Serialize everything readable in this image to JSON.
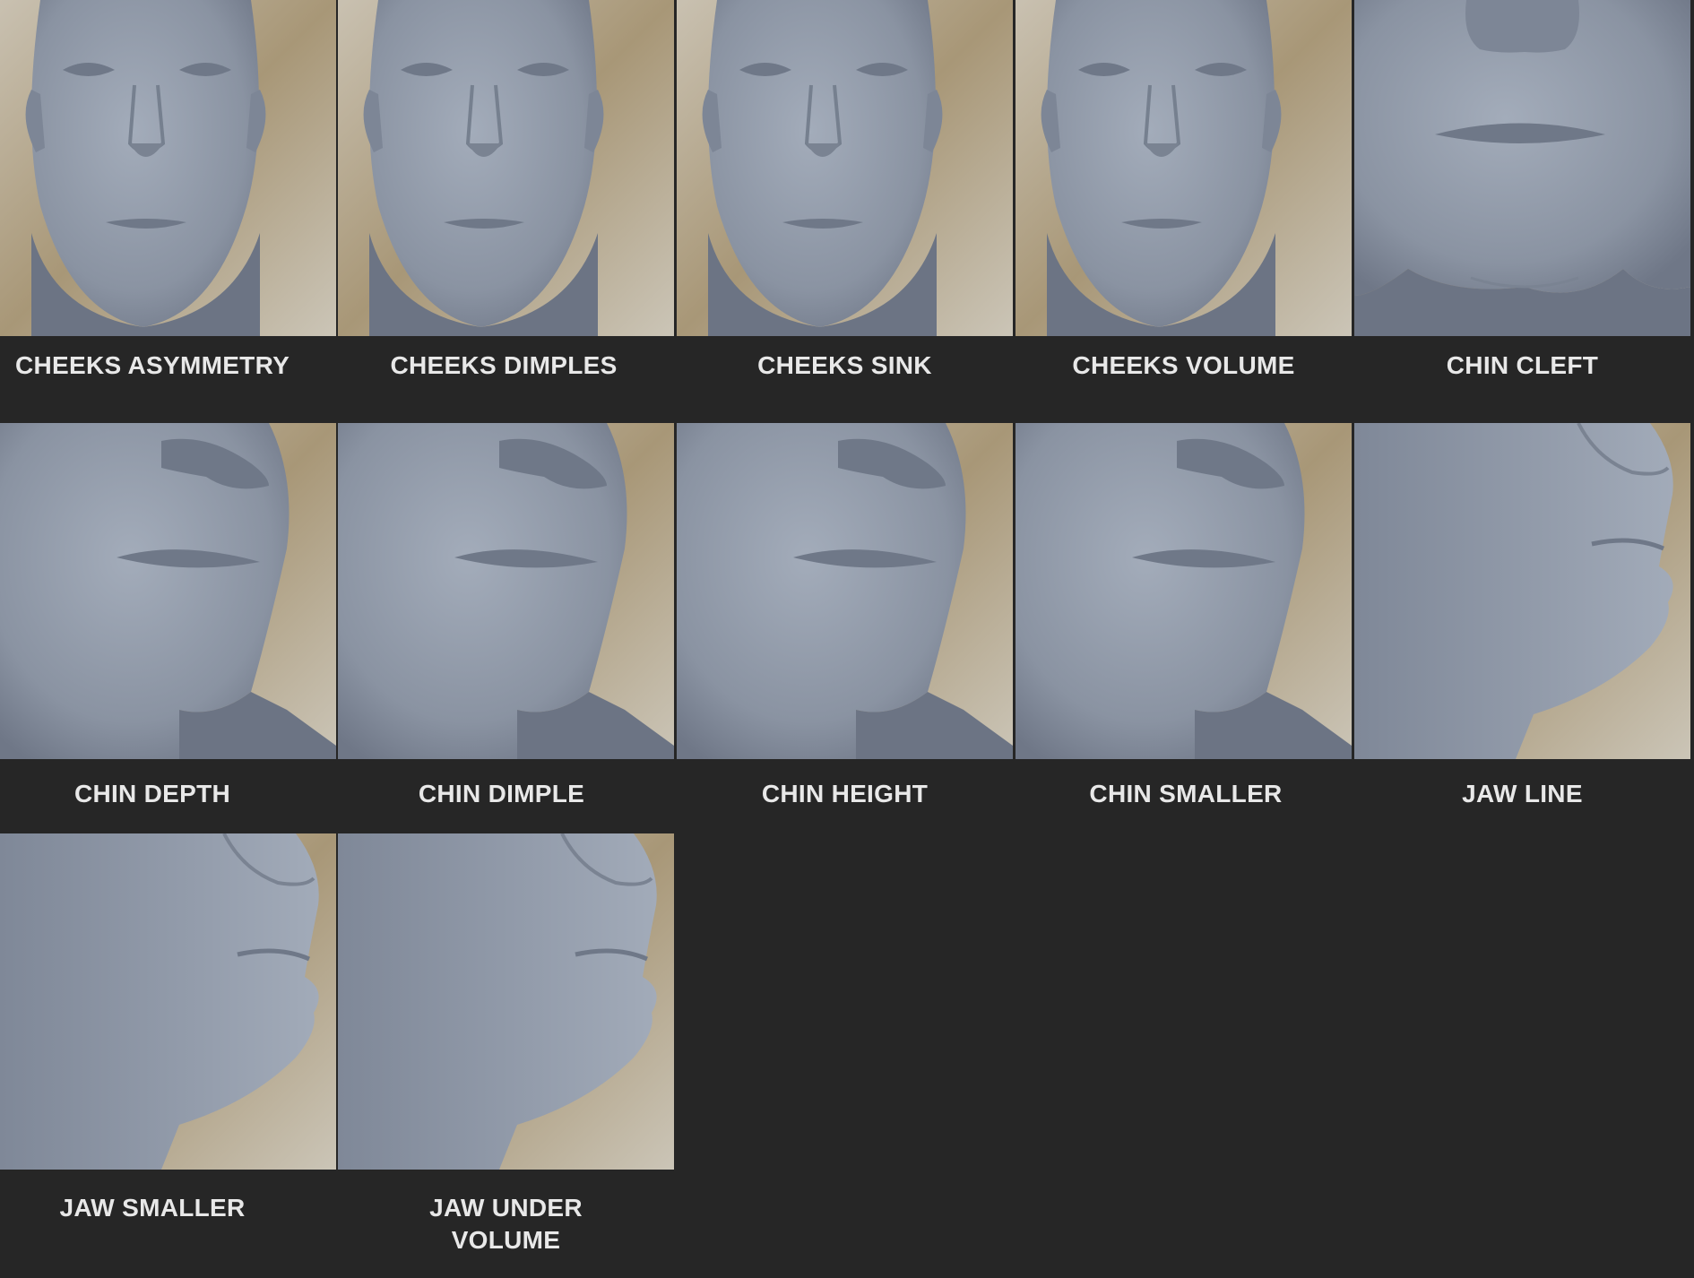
{
  "grid": {
    "row_1": [
      {
        "label": "CHEEKS ASYMMETRY",
        "view": "front-face"
      },
      {
        "label": "CHEEKS DIMPLES",
        "view": "front-face"
      },
      {
        "label": "CHEEKS SINK",
        "view": "front-face"
      },
      {
        "label": "CHEEKS VOLUME",
        "view": "front-face"
      },
      {
        "label": "CHIN CLEFT",
        "view": "front-lower-face"
      }
    ],
    "row_2": [
      {
        "label": "CHIN DEPTH",
        "view": "three-quarter-lower-face"
      },
      {
        "label": "CHIN DIMPLE",
        "view": "three-quarter-lower-face"
      },
      {
        "label": "CHIN HEIGHT",
        "view": "three-quarter-lower-face"
      },
      {
        "label": "CHIN SMALLER",
        "view": "three-quarter-lower-face"
      },
      {
        "label": "JAW LINE",
        "view": "side-lower-face"
      }
    ],
    "row_3": [
      {
        "label": "JAW SMALLER",
        "view": "side-lower-face"
      },
      {
        "label": "JAW UNDER VOLUME",
        "view": "side-lower-face"
      }
    ]
  },
  "colors": {
    "background": "#262626",
    "label_text": "#e8e8e8",
    "skin": "#8f98a6",
    "backdrop": "#b5a68a"
  }
}
